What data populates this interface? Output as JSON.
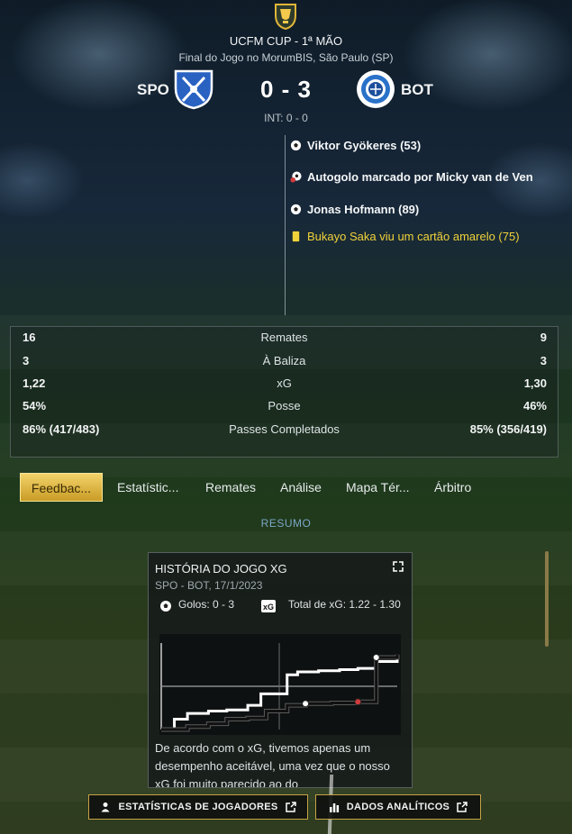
{
  "header": {
    "competition": "UCFM CUP - 1ª MÃO",
    "venue": "Final do Jogo no MorumBIS, São Paulo (SP)",
    "home_team": "SPO",
    "away_team": "BOT",
    "score": "0 - 3",
    "half_time": "INT: 0 - 0",
    "logo_icon": "cup-trophy-icon"
  },
  "events": [
    {
      "icon": "goal-ball-icon",
      "text": "Viktor Gyökeres (53)",
      "type": "goal"
    },
    {
      "icon": "own-goal-ball-icon",
      "text": "Autogolo marcado por Micky van de Ven",
      "type": "own-goal"
    },
    {
      "icon": "goal-ball-icon",
      "text": "Jonas Hofmann (89)",
      "type": "goal"
    },
    {
      "icon": "yellow-card-icon",
      "text": "Bukayo Saka viu um cartão amarelo (75)",
      "type": "yellow-card"
    }
  ],
  "stats": [
    {
      "label": "Remates",
      "home": "16",
      "away": "9"
    },
    {
      "label": "À Baliza",
      "home": "3",
      "away": "3"
    },
    {
      "label": "xG",
      "home": "1,22",
      "away": "1,30"
    },
    {
      "label": "Posse",
      "home": "54%",
      "away": "46%"
    },
    {
      "label": "Passes Completados",
      "home": "86% (417/483)",
      "away": "85% (356/419)"
    }
  ],
  "tabs": [
    {
      "label": "Feedbac...",
      "active": true
    },
    {
      "label": "Estatístic...",
      "active": false
    },
    {
      "label": "Remates",
      "active": false
    },
    {
      "label": "Análise",
      "active": false
    },
    {
      "label": "Mapa Tér...",
      "active": false
    },
    {
      "label": "Árbitro",
      "active": false
    }
  ],
  "section_label": "RESUMO",
  "card": {
    "title": "HISTÓRIA DO JOGO XG",
    "subtitle": "SPO - BOT, 17/1/2023",
    "goals_label": "Golos: 0 - 3",
    "xg_total_label": "Total de xG: 1.22 - 1.30",
    "text": "De acordo com o xG, tivemos apenas um desempenho aceitável, uma vez que o nosso xG foi muito parecido ao do",
    "chart_data": {
      "type": "line",
      "xlim": [
        0,
        90
      ],
      "ylim": [
        0,
        1.5
      ],
      "series": [
        {
          "color": "#ffffff",
          "x": [
            0,
            5,
            10,
            18,
            25,
            33,
            38,
            48,
            52,
            60,
            68,
            75,
            82,
            90
          ],
          "y": [
            0.0,
            0.18,
            0.28,
            0.32,
            0.34,
            0.42,
            0.62,
            0.95,
            1.0,
            1.02,
            1.04,
            1.06,
            1.18,
            1.22
          ]
        },
        {
          "color": "#111111",
          "x": [
            0,
            10,
            18,
            25,
            33,
            40,
            48,
            55,
            65,
            75,
            82,
            90
          ],
          "y": [
            0.0,
            0.05,
            0.1,
            0.18,
            0.2,
            0.32,
            0.42,
            0.45,
            0.46,
            0.48,
            1.25,
            1.3
          ]
        }
      ]
    }
  },
  "buttons": {
    "player_stats": "ESTATÍSTICAS DE JOGADORES",
    "analytics": "DADOS ANALÍTICOS"
  },
  "colors": {
    "accent_gold": "#c99c25",
    "yellow_card": "#f1d23a",
    "link_blue": "#7ba6c9"
  }
}
